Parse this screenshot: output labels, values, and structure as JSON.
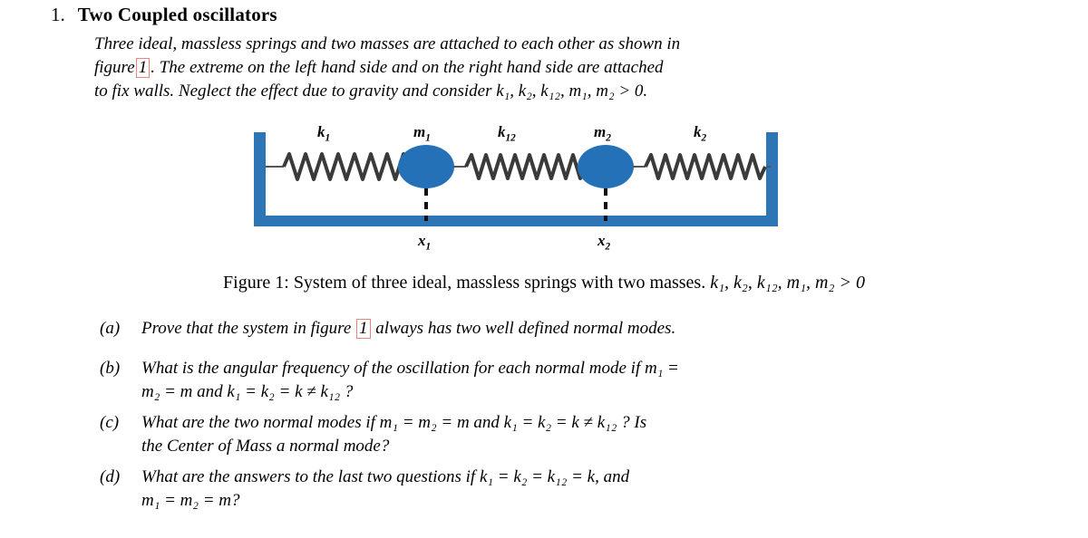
{
  "document": {
    "problem_number": "1.",
    "problem_title": "Two Coupled oscillators",
    "intro": {
      "line1": "Three ideal, massless springs and two masses are attached to each other as shown in",
      "line2_before": "figure",
      "line2_reflink": "1",
      "line2_after": ".  The extreme on the left hand side and on the right hand side are attached",
      "line3_text": "to fix walls.  Neglect the effect due to gravity and consider",
      "line3_math": "k₁, k₂, k₁₂, m₁, m₂ > 0."
    },
    "caption": {
      "label": "Figure 1:",
      "text": "System of three ideal, massless springs with two masses.",
      "math": "k₁, k₂, k₁₂, m₁, m₂ > 0"
    }
  },
  "figure": {
    "name": "two-coupled-oscillators-diagram",
    "colors": {
      "frame_blue": "#2E75B6",
      "mass_blue": "#2471B8",
      "spring_dark": "#3A3A3A",
      "rod": "#555555"
    },
    "labels": {
      "k1": "k₁",
      "m1": "m₁",
      "k12": "k₁₂",
      "m2": "m₂",
      "k2": "k₂",
      "x1": "x₁",
      "x2": "x₂"
    },
    "label_parts": {
      "k1": {
        "base": "k",
        "sub": "1"
      },
      "m1": {
        "base": "m",
        "sub": "1"
      },
      "k12": {
        "base": "k",
        "sub": "12"
      },
      "m2": {
        "base": "m",
        "sub": "2"
      },
      "k2": {
        "base": "k",
        "sub": "2"
      },
      "x1": {
        "base": "x",
        "sub": "1"
      },
      "x2": {
        "base": "x",
        "sub": "2"
      }
    }
  },
  "items": [
    {
      "label": "(a)",
      "line1_before": "Prove that the system in figure",
      "line1_reflink": "1",
      "line1_after": "always has two well defined normal modes."
    },
    {
      "label": "(b)",
      "line1": "What is the angular frequency of the oscillation for each normal mode if m₁ =",
      "line2": "m₂ = m and k₁ = k₂ = k ≠ k₁₂ ?"
    },
    {
      "label": "(c)",
      "line1": "What are the two normal modes if m₁ = m₂ = m and k₁ = k₂ = k ≠ k₁₂ ?  Is",
      "line2": "the Center of Mass a normal mode?"
    },
    {
      "label": "(d)",
      "line1": "What are the answers to the last two questions if k₁ = k₂ = k₁₂ = k, and",
      "line2": "m₁ = m₂ = m?"
    }
  ]
}
